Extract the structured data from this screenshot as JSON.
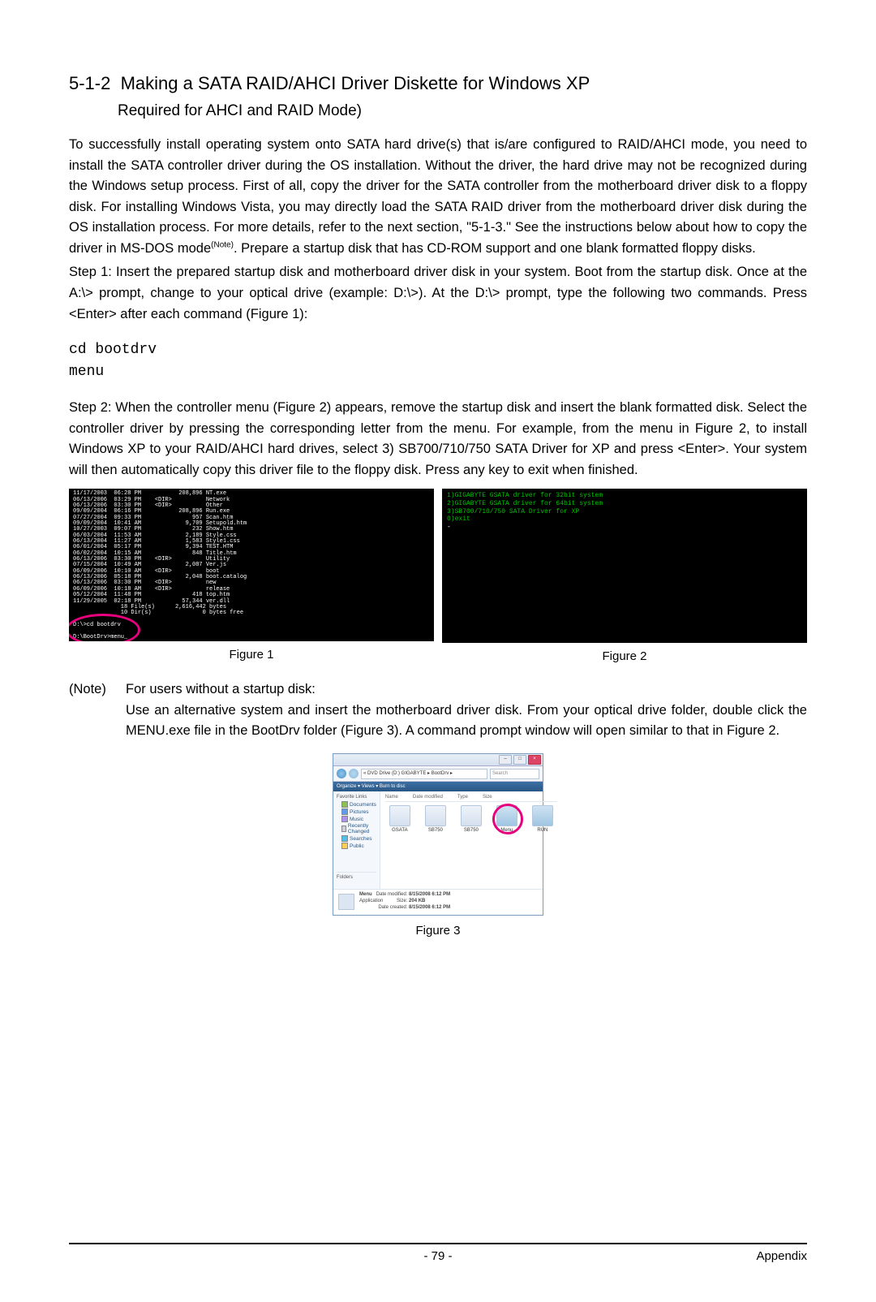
{
  "heading": {
    "number": "5-1-2",
    "title": "Making a SATA RAID/AHCI Driver Diskette for Windows XP",
    "subtitle": "Required for AHCI and RAID Mode)"
  },
  "para1_a": "To successfully install operating system onto SATA hard drive(s) that is/are configured to RAID/AHCI mode, you need to install the SATA controller driver during the OS installation. Without the driver, the hard drive may not be recognized during the Windows setup process. First of all, copy the driver for the SATA controller from the motherboard driver disk to a floppy disk. For installing Windows Vista, you may directly load the SATA RAID driver from the motherboard driver disk during the OS installation process. For more details, refer to the next section, \"5-1-3.\" See the instructions below about how to copy the driver in MS-DOS mode",
  "para1_note_sup": "(Note)",
  "para1_b": ". Prepare a startup disk that has CD-ROM support and one blank formatted floppy disks.",
  "para2": "Step 1: Insert the prepared startup disk and motherboard driver disk in your system. Boot from the startup disk. Once at the A:\\> prompt, change to your optical drive (example: D:\\>). At the D:\\> prompt, type the following two commands. Press <Enter> after each command (Figure 1):",
  "code": {
    "line1": "cd bootdrv",
    "line2": "menu"
  },
  "para3": "Step 2: When the controller menu (Figure 2) appears, remove the startup disk and insert the blank formatted disk. Select the controller driver by pressing the corresponding letter from the menu. For example, from the menu in Figure 2, to install Windows XP to your RAID/AHCI hard drives, select 3) SB700/710/750 SATA Driver for XP and press <Enter>. Your system will then automatically copy this driver file to the floppy disk. Press any key to exit when finished.",
  "figure1": {
    "label": "Figure 1",
    "listing": "11/17/2003  06:28 PM           208,896 NT.exe\n06/13/2006  03:29 PM    <DIR>          Network\n06/13/2006  03:30 PM    <DIR>          Other\n09/09/2004  06:16 PM           208,896 Run.exe\n07/27/2004  09:33 PM               957 Scan.htm\n09/09/2004  10:41 AM             9,709 Setupold.htm\n10/27/2003  09:07 PM               232 Show.htm\n06/03/2004  11:53 AM             2,189 Style.css\n06/13/2004  11:27 AM             1,583 Style1.css\n06/01/2004  05:17 PM             9,394 TEST.HTM\n06/02/2004  10:15 AM               848 Title.htm\n06/13/2006  03:30 PM    <DIR>          Utility\n07/15/2004  10:49 AM             2,087 Ver.js\n06/09/2006  10:10 AM    <DIR>          boot\n06/13/2006  05:18 PM             2,048 boot.catalog\n06/13/2006  03:30 PM    <DIR>          new\n06/09/2006  10:18 AM    <DIR>          release\n05/12/2004  11:48 PM               418 top.htm\n11/29/2005  02:18 PM            57,344 ver.dll\n              18 File(s)      2,616,442 bytes\n              10 Dir(s)               0 bytes free",
    "cmd1": "D:\\>cd bootdrv",
    "cmd2": "D:\\BootDrv>menu_"
  },
  "figure2": {
    "label": "Figure 2",
    "lines": [
      "1)GIGABYTE GSATA driver for 32bit system",
      "2)GIGABYTE GSATA driver for 64bit system",
      "3)SB700/710/750 SATA Driver for XP",
      "0)exit",
      "-"
    ]
  },
  "note": {
    "label": "(Note)",
    "text_a": "For users without a startup disk:",
    "text_b": "Use an alternative system and insert the motherboard driver disk. From your optical drive folder, double click the MENU.exe file in the BootDrv folder (Figure 3). A command prompt window will open similar to that in Figure 2."
  },
  "figure3": {
    "label": "Figure 3",
    "nav_path": "« DVD Drive (D:) GIGABYTE ▸ BootDrv ▸",
    "search_placeholder": "Search",
    "toolbar": "Organize ▾   Views ▾   Burn to disc",
    "sidebar": {
      "header": "Favorite Links",
      "items": [
        "Documents",
        "Pictures",
        "Music",
        "Recently Changed",
        "Searches",
        "Public"
      ],
      "folders": "Folders"
    },
    "columns": [
      "Name",
      "Date modified",
      "Type",
      "Size"
    ],
    "files": [
      "GSATA",
      "SB750",
      "SB750",
      "Menu",
      "RUN"
    ],
    "footer": {
      "name": "Menu",
      "type": "Application",
      "modified_label": "Date modified:",
      "modified": "8/15/2008 6:12 PM",
      "size_label": "Size:",
      "size": "204 KB",
      "created_label": "Date created:",
      "created": "8/15/2008 6:12 PM"
    }
  },
  "footer": {
    "page": "- 79 -",
    "section": "Appendix"
  }
}
